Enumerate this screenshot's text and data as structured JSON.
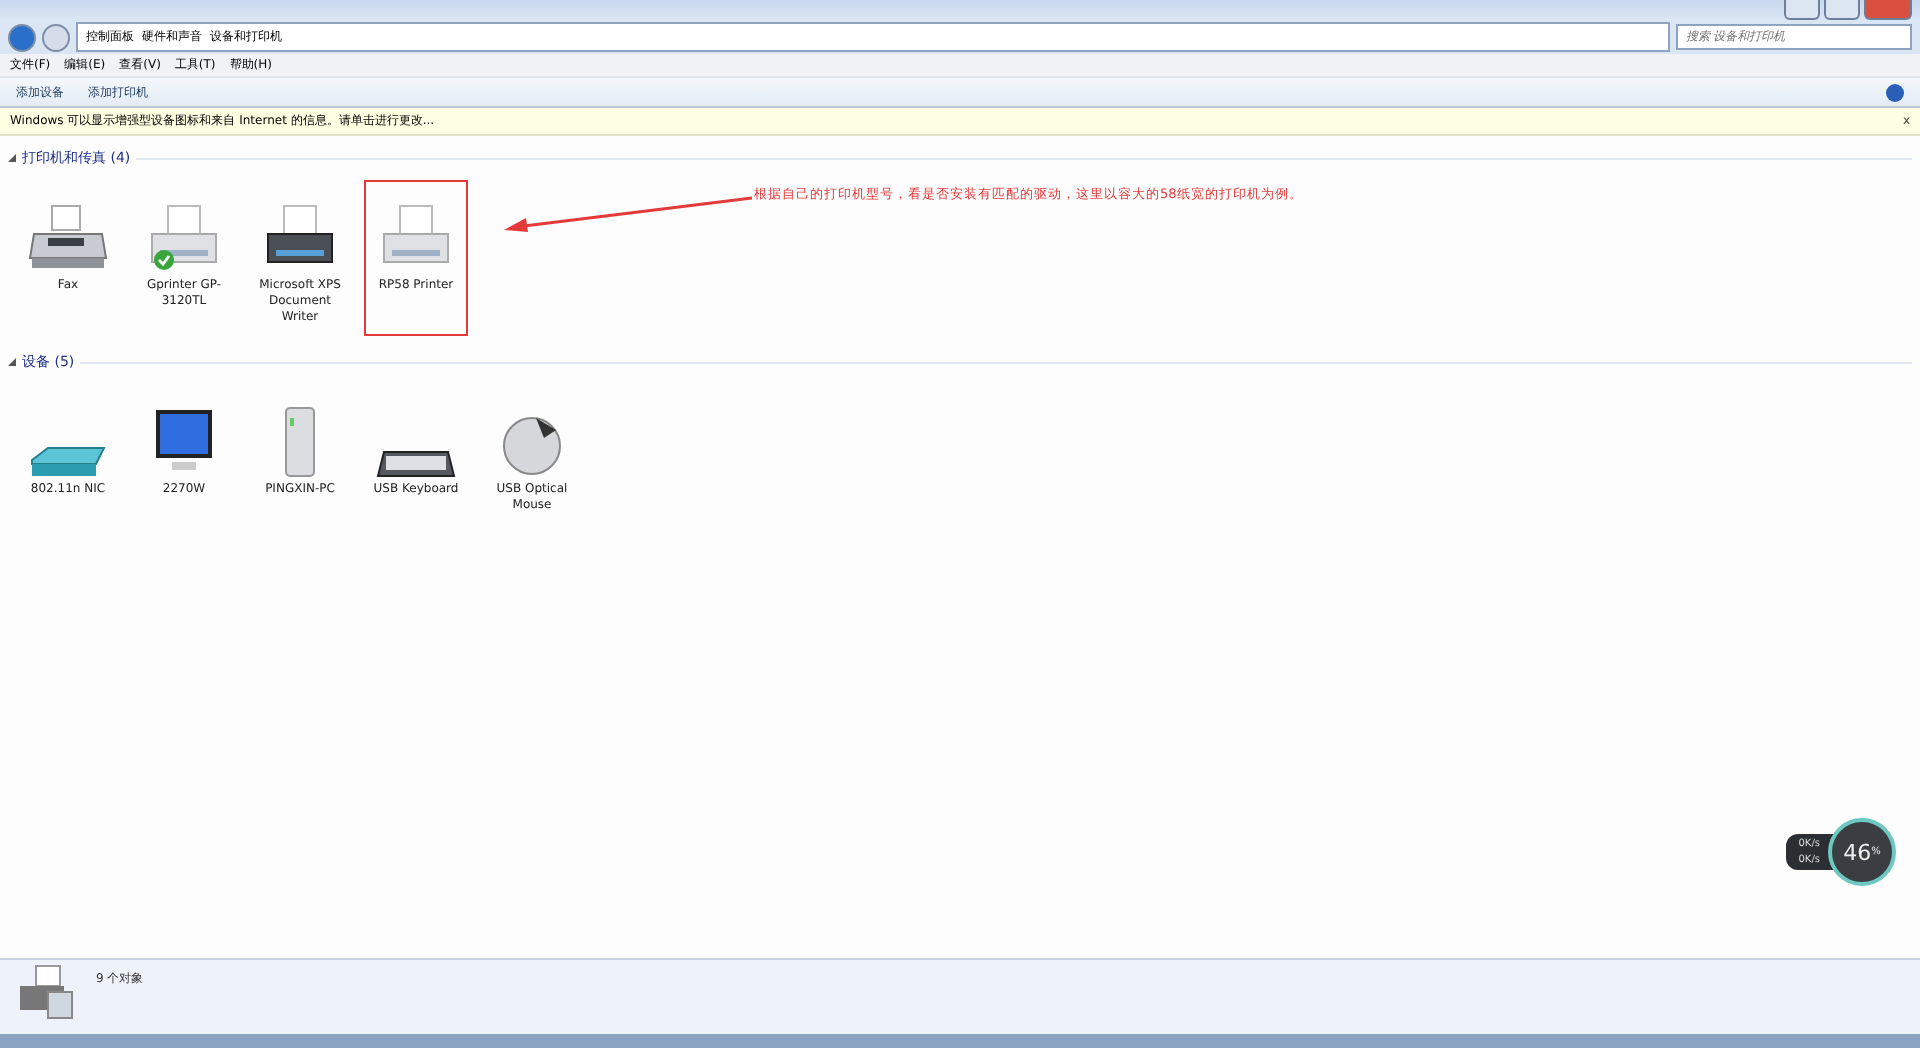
{
  "address_bar": {
    "breadcrumbs": [
      "控制面板",
      "硬件和声音",
      "设备和打印机"
    ],
    "search_placeholder": "搜索 设备和打印机"
  },
  "menu": [
    "文件(F)",
    "编辑(E)",
    "查看(V)",
    "工具(T)",
    "帮助(H)"
  ],
  "toolbar": [
    "添加设备",
    "添加打印机"
  ],
  "info_bar": {
    "text": "Windows 可以显示增强型设备图标和来自 Internet 的信息。请单击进行更改...",
    "close": "x"
  },
  "sections": [
    {
      "title": "打印机和传真 (4)",
      "items": [
        {
          "kind": "fax",
          "label": "Fax",
          "default": false,
          "annotated": false
        },
        {
          "kind": "printer",
          "label": "Gprinter GP-3120TL",
          "default": true,
          "annotated": false
        },
        {
          "kind": "xps",
          "label": "Microsoft XPS Document Writer",
          "default": false,
          "annotated": false
        },
        {
          "kind": "printer",
          "label": "RP58 Printer",
          "default": false,
          "annotated": true
        }
      ]
    },
    {
      "title": "设备 (5)",
      "items": [
        {
          "kind": "router",
          "label": "802.11n NIC",
          "default": false,
          "annotated": false
        },
        {
          "kind": "monitor",
          "label": "2270W",
          "default": false,
          "annotated": false
        },
        {
          "kind": "pc",
          "label": "PINGXIN-PC",
          "default": false,
          "annotated": false
        },
        {
          "kind": "keyboard",
          "label": "USB Keyboard",
          "default": false,
          "annotated": false
        },
        {
          "kind": "mouse",
          "label": "USB Optical Mouse",
          "default": false,
          "annotated": false
        }
      ]
    }
  ],
  "annotation": "根据自己的打印机型号，看是否安装有匹配的驱动，这里以容大的58纸宽的打印机为例。",
  "status_bar": {
    "count": "9 个对象"
  },
  "speed_widget": {
    "percent": "46",
    "unit": "%",
    "upload": "0K/s",
    "download": "0K/s"
  }
}
